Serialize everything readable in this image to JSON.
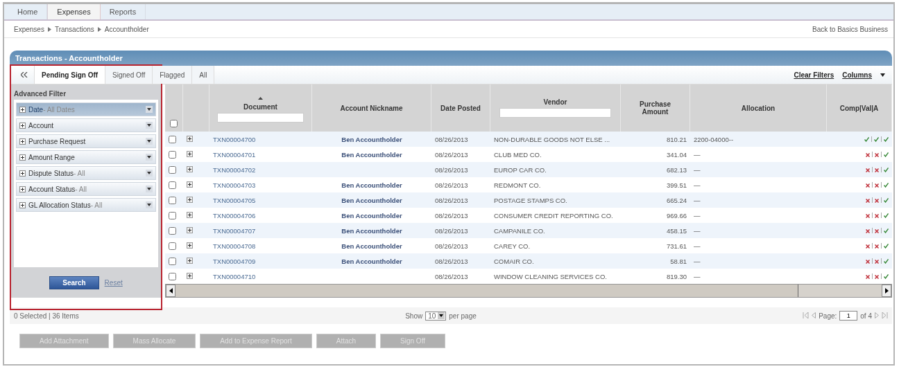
{
  "nav_tabs": [
    {
      "label": "Home",
      "selected": false
    },
    {
      "label": "Expenses",
      "selected": true
    },
    {
      "label": "Reports",
      "selected": false
    }
  ],
  "breadcrumb": [
    "Expenses",
    "Transactions",
    "Accountholder"
  ],
  "back_link": "Back to Basics Business",
  "panel_title": "Transactions - Accountholder",
  "view_tabs": [
    {
      "label": "Pending Sign Off",
      "selected": true
    },
    {
      "label": "Signed Off",
      "selected": false
    },
    {
      "label": "Flagged",
      "selected": false
    },
    {
      "label": "All",
      "selected": false
    }
  ],
  "toolbar_links": [
    "Clear Filters",
    "Columns"
  ],
  "filter": {
    "title": "Advanced Filter",
    "items": [
      {
        "label": "Date",
        "value": "- All Dates",
        "selected": true
      },
      {
        "label": "Account",
        "selected": false
      },
      {
        "label": "Purchase Request",
        "selected": false
      },
      {
        "label": "Amount Range",
        "selected": false
      },
      {
        "label": "Dispute Status",
        "value": "- All",
        "selected": false
      },
      {
        "label": "Account Status",
        "value": "- All",
        "selected": false
      },
      {
        "label": "GL Allocation Status",
        "value": "- All",
        "selected": false
      }
    ],
    "search_button": "Search",
    "reset_link": "Reset"
  },
  "table": {
    "select_all_checked": false,
    "columns": [
      "Document",
      "Account Nickname",
      "Date Posted",
      "Vendor",
      "Purchase Amount",
      "Allocation",
      "Comp|Val|A"
    ],
    "rows": [
      {
        "checked": false,
        "document": "TXN00004700",
        "nickname": "Ben Accountholder",
        "date": "08/26/2013",
        "vendor": "NON-DURABLE GOODS NOT ELSE ...",
        "amount": "810.21",
        "allocation": "2200-04000--",
        "checks": [
          true,
          true,
          true
        ]
      },
      {
        "checked": false,
        "document": "TXN00004701",
        "nickname": "Ben Accountholder",
        "date": "08/26/2013",
        "vendor": "CLUB MED CO.",
        "amount": "341.04",
        "allocation": "—",
        "checks": [
          false,
          false,
          true
        ]
      },
      {
        "checked": false,
        "document": "TXN00004702",
        "date": "08/26/2013",
        "vendor": "EUROP CAR CO.",
        "amount": "682.13",
        "allocation": "—",
        "checks": [
          false,
          false,
          true
        ]
      },
      {
        "checked": false,
        "document": "TXN00004703",
        "nickname": "Ben Accountholder",
        "date": "08/26/2013",
        "vendor": "REDMONT CO.",
        "amount": "399.51",
        "allocation": "—",
        "checks": [
          false,
          false,
          true
        ]
      },
      {
        "checked": false,
        "document": "TXN00004705",
        "nickname": "Ben Accountholder",
        "date": "08/26/2013",
        "vendor": "POSTAGE STAMPS CO.",
        "amount": "665.24",
        "allocation": "—",
        "checks": [
          false,
          false,
          true
        ]
      },
      {
        "checked": false,
        "document": "TXN00004706",
        "nickname": "Ben Accountholder",
        "date": "08/26/2013",
        "vendor": "CONSUMER CREDIT REPORTING CO.",
        "amount": "969.66",
        "allocation": "—",
        "checks": [
          false,
          false,
          true
        ]
      },
      {
        "checked": false,
        "document": "TXN00004707",
        "nickname": "Ben Accountholder",
        "date": "08/26/2013",
        "vendor": "CAMPANILE CO.",
        "amount": "458.15",
        "allocation": "—",
        "checks": [
          false,
          false,
          true
        ]
      },
      {
        "checked": false,
        "document": "TXN00004708",
        "nickname": "Ben Accountholder",
        "date": "08/26/2013",
        "vendor": "CAREY CO.",
        "amount": "731.61",
        "allocation": "—",
        "checks": [
          false,
          false,
          true
        ]
      },
      {
        "checked": false,
        "document": "TXN00004709",
        "nickname": "Ben Accountholder",
        "date": "08/26/2013",
        "vendor": "COMAIR CO.",
        "amount": "58.81",
        "allocation": "—",
        "checks": [
          false,
          false,
          true
        ]
      },
      {
        "checked": false,
        "document": "TXN00004710",
        "date": "08/26/2013",
        "vendor": "WINDOW CLEANING SERVICES CO.",
        "amount": "819.30",
        "allocation": "—",
        "checks": [
          false,
          false,
          true
        ]
      }
    ]
  },
  "footer": {
    "summary": "0 Selected | 36 Items",
    "show_label": "Show",
    "per_page": "10",
    "per_page_label": "per page",
    "page_label": "Page:",
    "page": "1",
    "page_total": "of 4"
  },
  "actions": [
    {
      "label": "Add Attachment",
      "disabled": true
    },
    {
      "label": "Mass Allocate",
      "disabled": true
    },
    {
      "label": "Add to Expense Report",
      "disabled": true
    },
    {
      "label": "Attach",
      "disabled": true
    },
    {
      "label": "Sign Off",
      "disabled": true
    }
  ]
}
